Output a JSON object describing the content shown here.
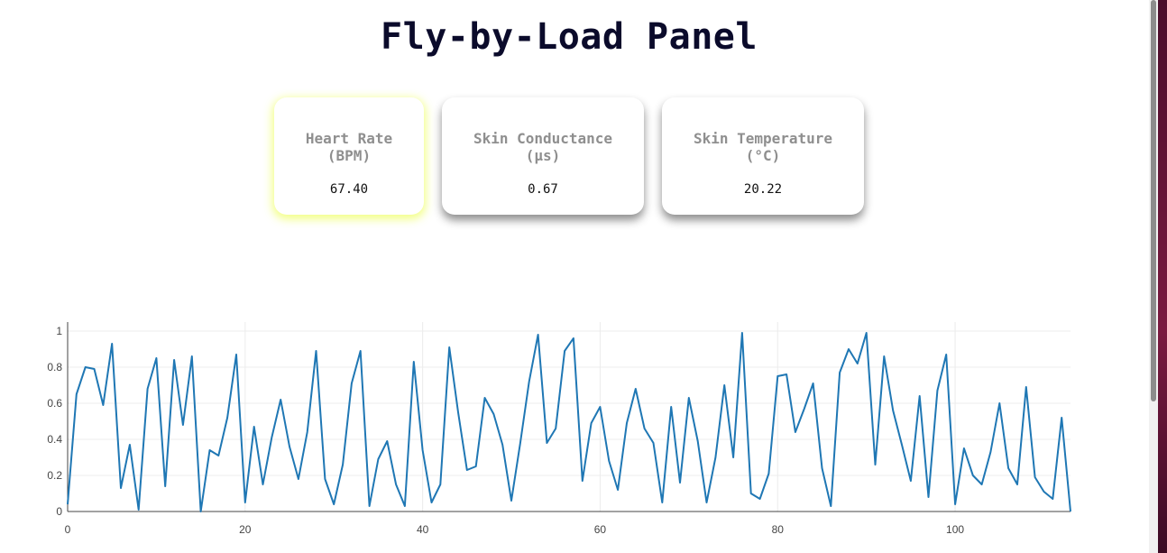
{
  "page": {
    "title": "Fly-by-Load Panel"
  },
  "cards": [
    {
      "label": "Heart Rate\n(BPM)",
      "value": "67.40"
    },
    {
      "label": "Skin Conductance\n(μs)",
      "value": "0.67"
    },
    {
      "label": "Skin Temperature\n(°C)",
      "value": "20.22"
    }
  ],
  "colors": {
    "line": "#1f77b4",
    "title": "#0b0b2b",
    "card_label": "#8f8f8f",
    "highlight_glow": "#f0ff6e"
  },
  "chart_data": {
    "type": "line",
    "title": "",
    "xlabel": "",
    "ylabel": "",
    "xlim": [
      0,
      113
    ],
    "ylim": [
      0,
      1.05
    ],
    "grid": true,
    "x_ticks": [
      0,
      20,
      40,
      60,
      80,
      100
    ],
    "y_ticks": [
      0,
      0.2,
      0.4,
      0.6,
      0.8,
      1
    ],
    "y_tick_labels": [
      "0",
      "0.2",
      "0.4",
      "0.6",
      "0.8",
      "1"
    ],
    "series": [
      {
        "values": [
          0.04,
          0.65,
          0.8,
          0.79,
          0.59,
          0.93,
          0.13,
          0.37,
          0.01,
          0.68,
          0.85,
          0.14,
          0.84,
          0.48,
          0.86,
          0.0,
          0.34,
          0.31,
          0.52,
          0.87,
          0.05,
          0.47,
          0.15,
          0.41,
          0.62,
          0.36,
          0.18,
          0.44,
          0.89,
          0.18,
          0.04,
          0.26,
          0.71,
          0.89,
          0.03,
          0.29,
          0.39,
          0.15,
          0.03,
          0.83,
          0.34,
          0.05,
          0.15,
          0.91,
          0.55,
          0.23,
          0.25,
          0.63,
          0.54,
          0.37,
          0.06,
          0.38,
          0.72,
          0.98,
          0.38,
          0.46,
          0.89,
          0.96,
          0.17,
          0.49,
          0.58,
          0.28,
          0.12,
          0.49,
          0.68,
          0.46,
          0.38,
          0.05,
          0.58,
          0.16,
          0.63,
          0.39,
          0.05,
          0.3,
          0.7,
          0.3,
          0.99,
          0.1,
          0.07,
          0.21,
          0.75,
          0.76,
          0.44,
          0.57,
          0.71,
          0.24,
          0.03,
          0.77,
          0.9,
          0.82,
          0.99,
          0.26,
          0.86,
          0.56,
          0.37,
          0.17,
          0.64,
          0.08,
          0.67,
          0.87,
          0.04,
          0.35,
          0.2,
          0.15,
          0.33,
          0.6,
          0.24,
          0.15,
          0.69,
          0.19,
          0.11,
          0.07,
          0.52,
          0.0
        ]
      }
    ]
  }
}
